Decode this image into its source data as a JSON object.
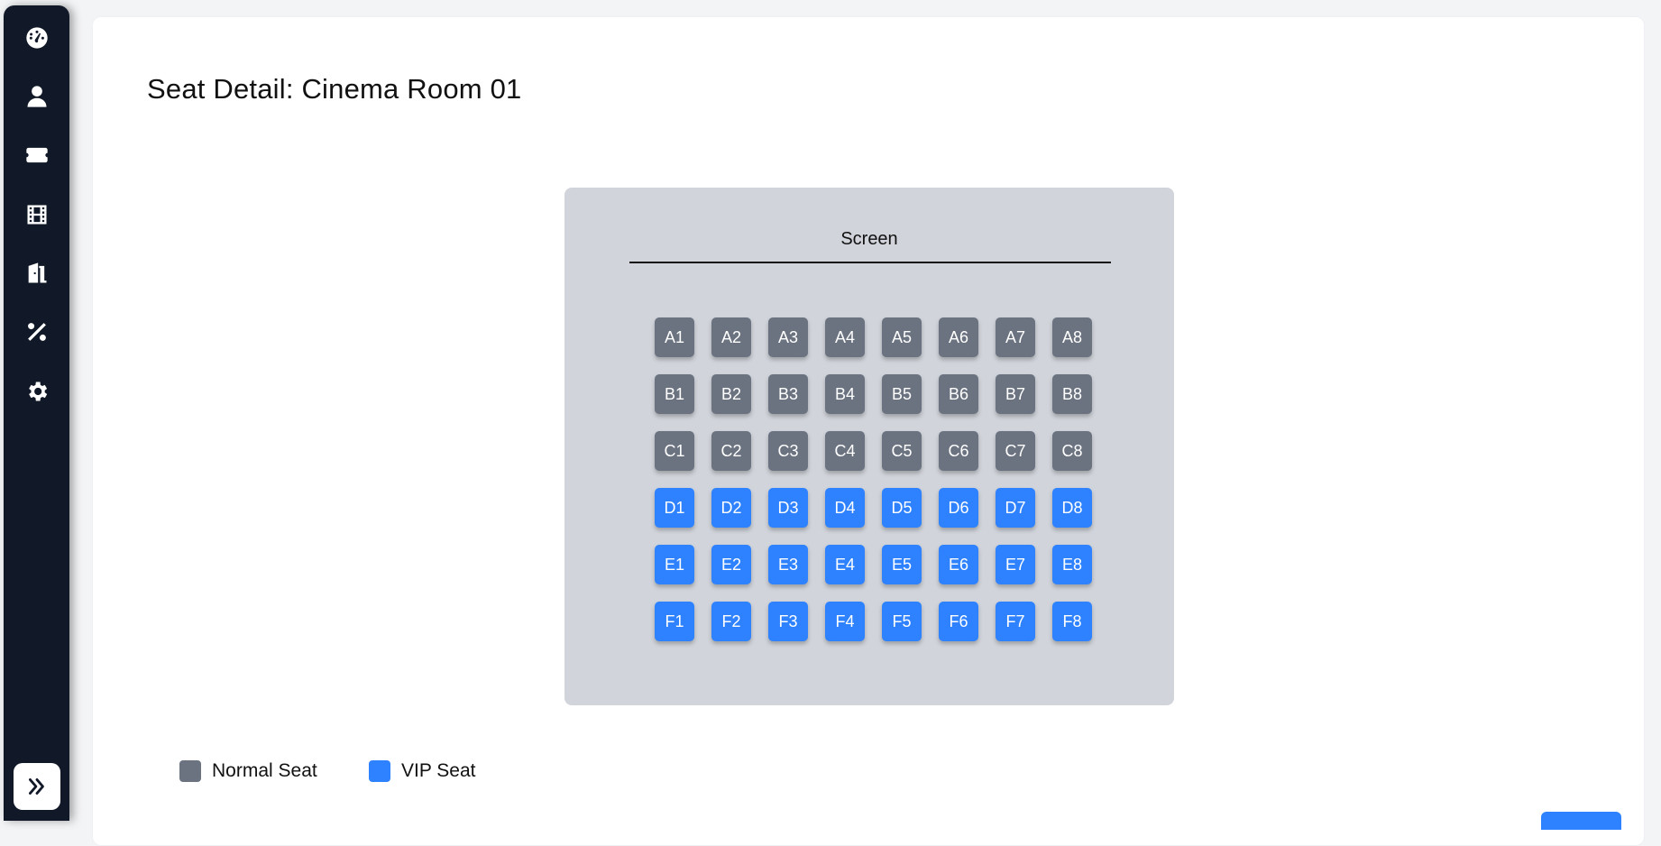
{
  "sidebar": {
    "items": [
      {
        "icon": "dashboard-gauge-icon"
      },
      {
        "icon": "user-icon"
      },
      {
        "icon": "ticket-icon"
      },
      {
        "icon": "film-icon"
      },
      {
        "icon": "door-room-icon"
      },
      {
        "icon": "percent-discount-icon"
      },
      {
        "icon": "gear-icon"
      }
    ],
    "expand_icon": "double-chevron-right-icon"
  },
  "page": {
    "title": "Seat Detail: Cinema Room 01"
  },
  "room": {
    "screen_label": "Screen",
    "rows": [
      {
        "row": "A",
        "type": "normal",
        "seats": [
          "A1",
          "A2",
          "A3",
          "A4",
          "A5",
          "A6",
          "A7",
          "A8"
        ]
      },
      {
        "row": "B",
        "type": "normal",
        "seats": [
          "B1",
          "B2",
          "B3",
          "B4",
          "B5",
          "B6",
          "B7",
          "B8"
        ]
      },
      {
        "row": "C",
        "type": "normal",
        "seats": [
          "C1",
          "C2",
          "C3",
          "C4",
          "C5",
          "C6",
          "C7",
          "C8"
        ]
      },
      {
        "row": "D",
        "type": "vip",
        "seats": [
          "D1",
          "D2",
          "D3",
          "D4",
          "D5",
          "D6",
          "D7",
          "D8"
        ]
      },
      {
        "row": "E",
        "type": "vip",
        "seats": [
          "E1",
          "E2",
          "E3",
          "E4",
          "E5",
          "E6",
          "E7",
          "E8"
        ]
      },
      {
        "row": "F",
        "type": "vip",
        "seats": [
          "F1",
          "F2",
          "F3",
          "F4",
          "F5",
          "F6",
          "F7",
          "F8"
        ]
      }
    ]
  },
  "legend": {
    "normal_label": "Normal Seat",
    "vip_label": "VIP Seat"
  },
  "colors": {
    "sidebar_bg": "#111827",
    "normal_seat": "#6b7280",
    "vip_seat": "#2e82ff",
    "room_bg": "#d1d5db"
  }
}
